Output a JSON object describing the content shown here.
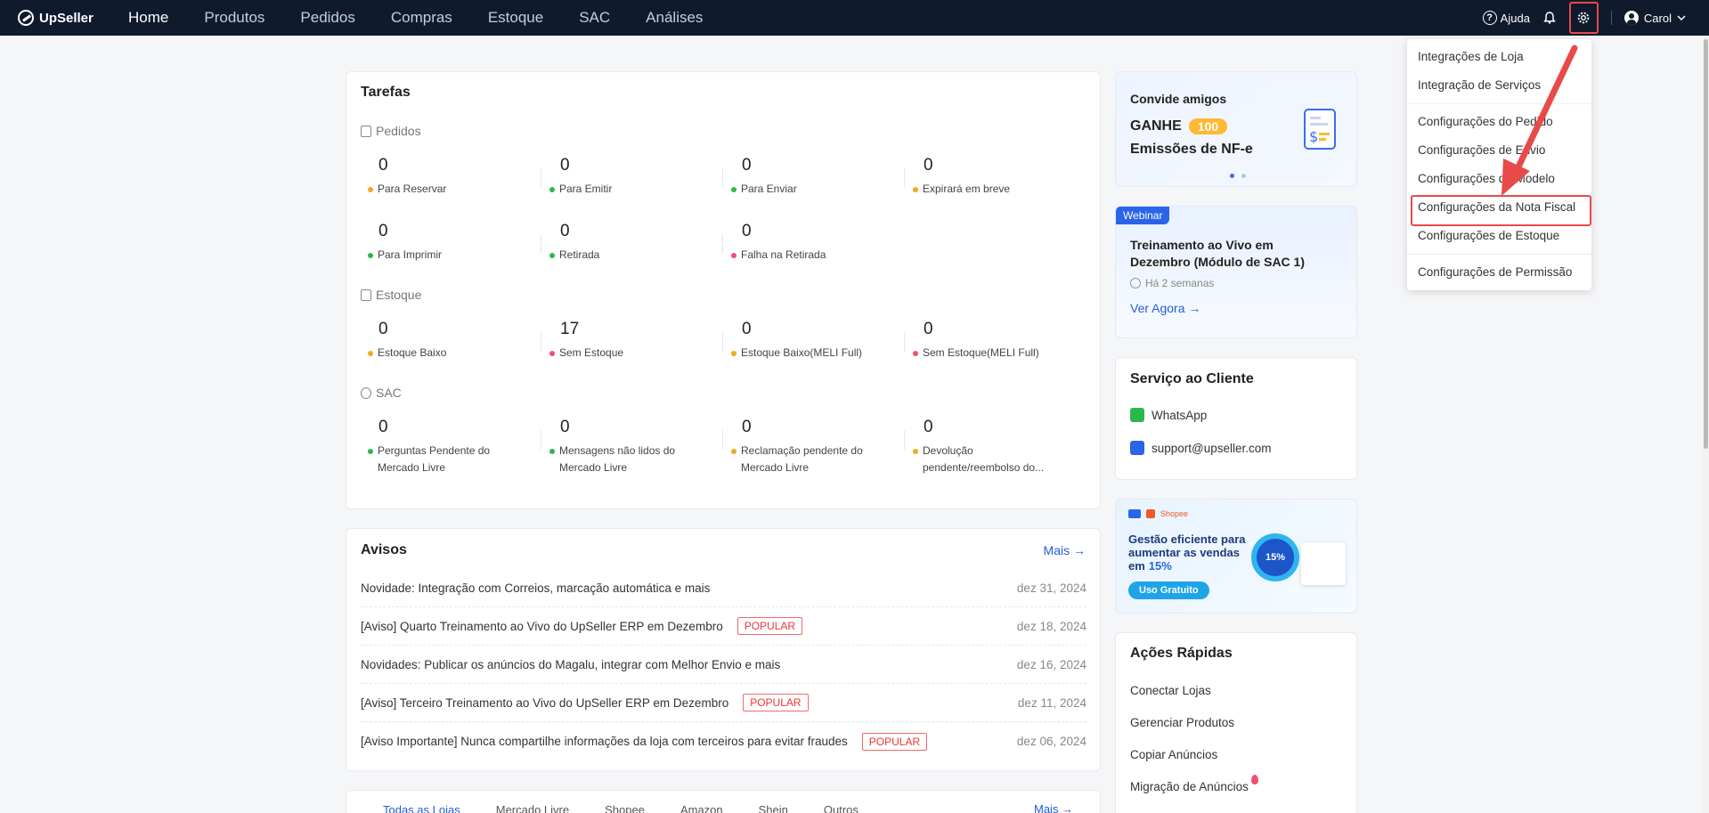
{
  "header": {
    "brand": "UpSeller",
    "nav": [
      "Home",
      "Produtos",
      "Pedidos",
      "Compras",
      "Estoque",
      "SAC",
      "Análises"
    ],
    "help": "Ajuda",
    "user": "Carol"
  },
  "tasks": {
    "title": "Tarefas",
    "pedidos": {
      "label": "Pedidos",
      "items": [
        {
          "value": "0",
          "label": "Para Reservar"
        },
        {
          "value": "0",
          "label": "Para Emitir"
        },
        {
          "value": "0",
          "label": "Para Enviar"
        },
        {
          "value": "0",
          "label": "Expirará em breve"
        },
        {
          "value": "0",
          "label": "Para Imprimir"
        },
        {
          "value": "0",
          "label": "Retirada"
        },
        {
          "value": "0",
          "label": "Falha na Retirada"
        }
      ]
    },
    "estoque": {
      "label": "Estoque",
      "items": [
        {
          "value": "0",
          "label": "Estoque Baixo"
        },
        {
          "value": "17",
          "label": "Sem Estoque"
        },
        {
          "value": "0",
          "label": "Estoque Baixo(MELI Full)"
        },
        {
          "value": "0",
          "label": "Sem Estoque(MELI Full)"
        }
      ]
    },
    "sac": {
      "label": "SAC",
      "items": [
        {
          "value": "0",
          "label": "Perguntas Pendente do Mercado Livre"
        },
        {
          "value": "0",
          "label": "Mensagens não lidos do Mercado Livre"
        },
        {
          "value": "0",
          "label": "Reclamação pendente do Mercado Livre"
        },
        {
          "value": "0",
          "label": "Devolução pendente/reembolso do..."
        }
      ]
    }
  },
  "notices": {
    "title": "Avisos",
    "more": "Mais →",
    "popular": "POPULAR",
    "items": [
      {
        "text": "Novidade: Integração com Correios, marcação automática e mais",
        "date": "dez 31, 2024"
      },
      {
        "text": "[Aviso] Quarto Treinamento ao Vivo do UpSeller ERP em Dezembro",
        "date": "dez 18, 2024"
      },
      {
        "text": "Novidades: Publicar os anúncios do Magalu, integrar com Melhor Envio e mais",
        "date": "dez 16, 2024"
      },
      {
        "text": "[Aviso] Terceiro Treinamento ao Vivo do UpSeller ERP em Dezembro",
        "date": "dez 11, 2024"
      },
      {
        "text": "[Aviso Importante] Nunca compartilhe informações da loja com terceiros para evitar fraudes",
        "date": "dez 06, 2024"
      }
    ]
  },
  "store_tabs": [
    "Todas as Lojas",
    "Mercado Livre",
    "Shopee",
    "Amazon",
    "Shein",
    "Outros"
  ],
  "store_more": "Mais →",
  "invite": {
    "title": "Convide amigos",
    "ganhe": "GANHE",
    "badge": "100",
    "line2": "Emissões de NF-e"
  },
  "webinar": {
    "tag": "Webinar",
    "title": "Treinamento ao Vivo em Dezembro (Módulo de SAC 1)",
    "time": "Há 2 semanas",
    "cta": "Ver Agora →"
  },
  "support": {
    "title": "Serviço ao Cliente",
    "whatsapp": "WhatsApp",
    "email": "support@upseller.com"
  },
  "promo": {
    "brand": "Shopee",
    "line1": "Gestão eficiente para",
    "line2": "aumentar as vendas",
    "line3a": "em",
    "pct": "15%",
    "cta": "Uso Gratuito",
    "badge": "15%"
  },
  "quick": {
    "title": "Ações Rápidas",
    "items": [
      "Conectar Lojas",
      "Gerenciar Produtos",
      "Copiar Anúncios",
      "Migração de Anúncios"
    ]
  },
  "settings_menu": [
    "Integrações de Loja",
    "Integração de Serviços",
    "Configurações do Pedido",
    "Configurações de Envio",
    "Configurações de Modelo",
    "Configurações da Nota Fiscal",
    "Configurações de Estoque",
    "Configurações de Permissão"
  ],
  "colors": {
    "topbar": "#0f1b2d",
    "accent": "#1f5fd6",
    "highlight": "#e84a4a",
    "dot_orange": "#f5a623",
    "dot_green": "#2db84d",
    "dot_red": "#f0506e"
  }
}
